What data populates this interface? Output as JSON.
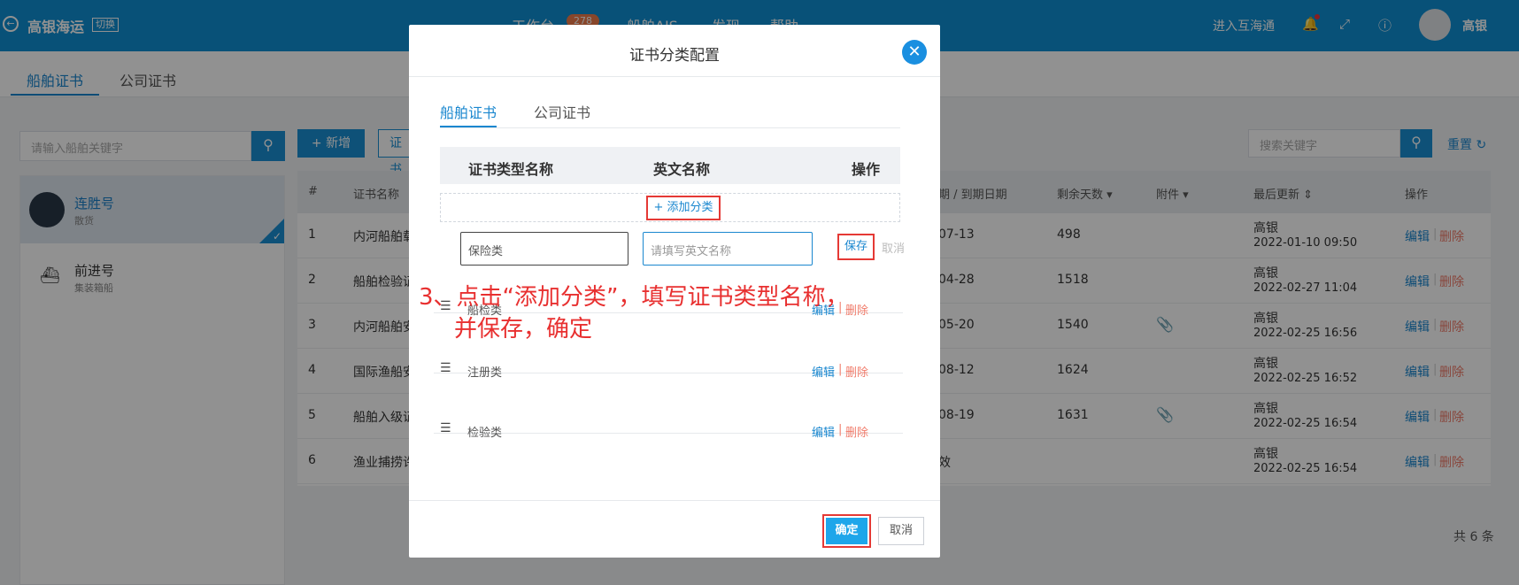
{
  "topbar": {
    "brand": "高银海运",
    "switch_label": "切换",
    "nav": [
      "工作台",
      "船舶AIS",
      "发现",
      "帮助"
    ],
    "workbench_badge": "278",
    "enter_label": "进入互海通",
    "user_name": "高银"
  },
  "page_tabs": [
    "船舶证书",
    "公司证书"
  ],
  "left": {
    "search_placeholder": "请输入船舶关键字",
    "ships": [
      {
        "name": "连胜号",
        "type": "散货"
      },
      {
        "name": "前进号",
        "type": "集装箱船"
      }
    ]
  },
  "toolbar": {
    "new_label": "+ 新增",
    "cert_label": "证书",
    "search_placeholder": "搜索关键字",
    "reset_label": "重置"
  },
  "table": {
    "headers": [
      "#",
      "证书名称",
      "期 / 到期日期",
      "剩余天数",
      "附件",
      "最后更新",
      "操作"
    ],
    "rows": [
      {
        "no": "1",
        "name": "内河船舶载",
        "date": "07-13",
        "days": "498",
        "updated_by": "高银",
        "updated_at": "2022-01-10 09:50"
      },
      {
        "no": "2",
        "name": "船舶检验证",
        "date": "04-28",
        "days": "1518",
        "updated_by": "高银",
        "updated_at": "2022-02-27 11:04"
      },
      {
        "no": "3",
        "name": "内河船舶安",
        "date": "05-20",
        "days": "1540",
        "updated_by": "高银",
        "updated_at": "2022-02-25 16:56"
      },
      {
        "no": "4",
        "name": "国际渔船安",
        "date": "08-12",
        "days": "1624",
        "updated_by": "高银",
        "updated_at": "2022-02-25 16:52"
      },
      {
        "no": "5",
        "name": "船舶入级证",
        "date": "08-19",
        "days": "1631",
        "updated_by": "高银",
        "updated_at": "2022-02-25 16:54"
      },
      {
        "no": "6",
        "name": "渔业捕捞许",
        "date": "效",
        "days": "",
        "updated_by": "高银",
        "updated_at": "2022-02-25 16:54"
      }
    ],
    "edit_label": "编辑",
    "delete_label": "删除",
    "total": "共 6 条"
  },
  "modal": {
    "title": "证书分类配置",
    "tabs": [
      "船舶证书",
      "公司证书"
    ],
    "headers": [
      "证书类型名称",
      "英文名称",
      "操作"
    ],
    "add_label": "+ 添加分类",
    "name_value": "保险类",
    "en_placeholder": "请填写英文名称",
    "save_label": "保存",
    "cancel_link": "取消",
    "rows": [
      "船检类",
      "注册类",
      "检验类"
    ],
    "edit_label": "编辑",
    "sep": "|",
    "delete_label": "删除",
    "ok_label": "确定",
    "cancel_label": "取消"
  },
  "annotation": {
    "line1": "3、点击“添加分类”，填写证书类型名称，",
    "line2": "并保存，确定"
  },
  "colors": {
    "primary": "#0f8fd3",
    "link": "#1a87cf",
    "danger": "#f07b6a",
    "highlight": "#e53935"
  }
}
